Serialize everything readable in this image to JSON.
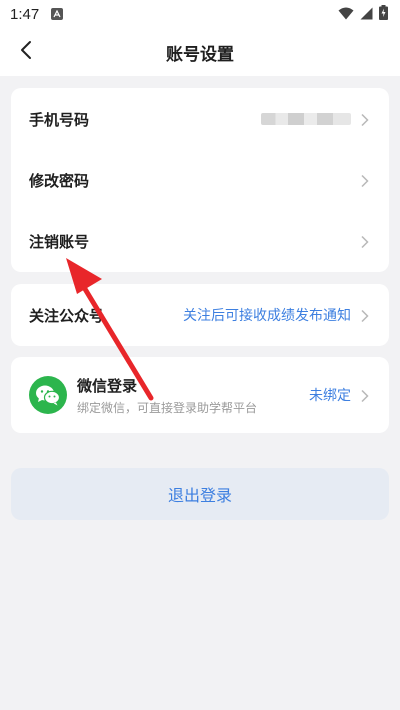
{
  "status_bar": {
    "time": "1:47",
    "notification_icon": "font-icon",
    "icons": [
      "wifi-icon",
      "signal-icon",
      "battery-charging-icon"
    ]
  },
  "header": {
    "title": "账号设置",
    "back_icon": "chevron-left-icon"
  },
  "account_card": {
    "items": [
      {
        "label": "手机号码",
        "value": "(blurred)"
      },
      {
        "label": "修改密码"
      },
      {
        "label": "注销账号"
      }
    ]
  },
  "official_account": {
    "label": "关注公众号",
    "hint": "关注后可接收成绩发布通知"
  },
  "wechat": {
    "title": "微信登录",
    "subtitle": "绑定微信，可直接登录助学帮平台",
    "status": "未绑定"
  },
  "logout": {
    "label": "退出登录"
  },
  "annotation": {
    "color": "#e8262a",
    "points_to": "注销账号"
  },
  "colors": {
    "accent": "#3d7fe0",
    "background": "#f2f2f4",
    "wechat_green": "#2cb54d",
    "logout_bg": "#e6ebf3"
  }
}
